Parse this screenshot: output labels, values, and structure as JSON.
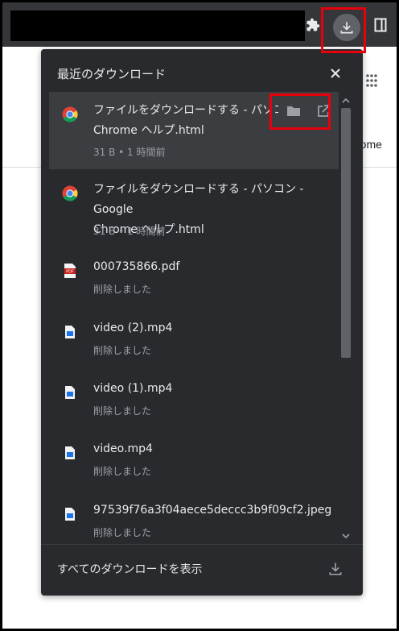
{
  "colors": {
    "toolbar": "#35363a",
    "panel": "#292a2d",
    "hover": "#3c3d41",
    "text": "#e8eaed",
    "subtext": "#9aa0a6",
    "highlight": "#e8000b"
  },
  "browser": {
    "background_text": "rome"
  },
  "panel": {
    "title": "最近のダウンロード",
    "close_icon": "close-icon",
    "footer_label": "すべてのダウンロードを表示"
  },
  "downloads": [
    {
      "icon": "chrome-icon",
      "name": "ファイルをダウンロードする - パソコン - Google Chrome ヘルプ.html",
      "name_display": "ファイルをダウンロードする - パソコン",
      "name_line2": "Chrome ヘルプ.html",
      "status": "31 B • 1 時間前"
    },
    {
      "icon": "chrome-icon",
      "name_display": "ファイルをダウンロードする - パソコン - Google",
      "name_line2": "Chrome ヘルプ.html",
      "status": "31 B • 1 時間前"
    },
    {
      "icon": "pdf-icon",
      "name_display": "000735866.pdf",
      "status": "削除しました"
    },
    {
      "icon": "video-file-icon",
      "name_display": "video (2).mp4",
      "status": "削除しました"
    },
    {
      "icon": "video-file-icon",
      "name_display": "video (1).mp4",
      "status": "削除しました"
    },
    {
      "icon": "video-file-icon",
      "name_display": "video.mp4",
      "status": "削除しました"
    },
    {
      "icon": "image-file-icon",
      "name_display": "97539f76a3f04aece5deccc3b9f09cf2.jpeg",
      "status": "削除しました"
    }
  ]
}
